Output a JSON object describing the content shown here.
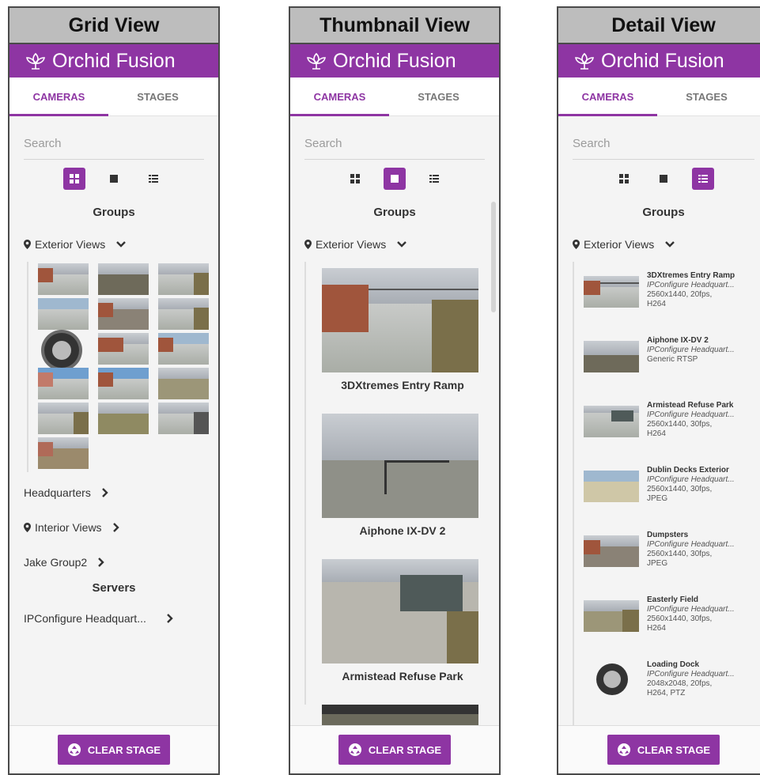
{
  "brand": "Orchid Fusion",
  "tabs": {
    "cameras": "CAMERAS",
    "stages": "STAGES"
  },
  "search_placeholder": "Search",
  "groups_heading": "Groups",
  "servers_heading": "Servers",
  "clear_stage": "CLEAR STAGE",
  "panels": {
    "grid": {
      "caption": "Grid View",
      "group": "Exterior Views",
      "other_groups": [
        "Headquarters",
        "Interior Views",
        "Jake Group2"
      ],
      "server": "IPConfigure Headquart..."
    },
    "thumb": {
      "caption": "Thumbnail View",
      "group": "Exterior Views",
      "cameras": [
        "3DXtremes Entry Ramp",
        "Aiphone IX-DV 2",
        "Armistead Refuse Park"
      ]
    },
    "detail": {
      "caption": "Detail View",
      "group": "Exterior Views",
      "cameras": [
        {
          "name": "3DXtremes Entry Ramp",
          "location": "IPConfigure Headquart...",
          "spec1": "2560x1440, 20fps,",
          "spec2": "H264"
        },
        {
          "name": "Aiphone IX-DV 2",
          "location": "IPConfigure Headquart...",
          "spec1": "Generic RTSP",
          "spec2": ""
        },
        {
          "name": "Armistead Refuse Park",
          "location": "IPConfigure Headquart...",
          "spec1": "2560x1440, 30fps,",
          "spec2": "H264"
        },
        {
          "name": "Dublin Decks Exterior",
          "location": "IPConfigure Headquart...",
          "spec1": "2560x1440, 30fps,",
          "spec2": "JPEG"
        },
        {
          "name": "Dumpsters",
          "location": "IPConfigure Headquart...",
          "spec1": "2560x1440, 30fps,",
          "spec2": "JPEG"
        },
        {
          "name": "Easterly Field",
          "location": "IPConfigure Headquart...",
          "spec1": "2560x1440, 30fps,",
          "spec2": "H264"
        },
        {
          "name": "Loading Dock",
          "location": "IPConfigure Headquart...",
          "spec1": "2048x2048, 20fps,",
          "spec2": "H264, PTZ"
        }
      ]
    }
  }
}
